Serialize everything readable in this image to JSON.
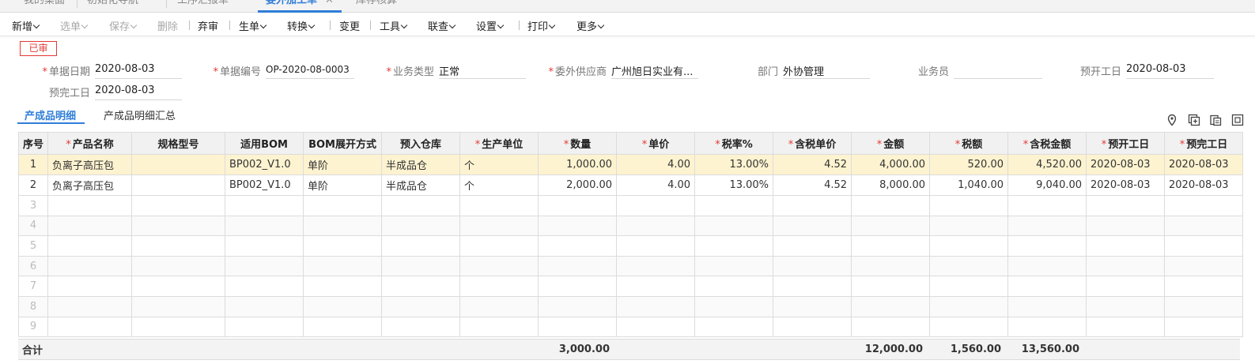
{
  "tabs": [
    {
      "label": "我的桌面"
    },
    {
      "label": "初始化导航"
    },
    {
      "label": "工序汇报单"
    },
    {
      "label": "委外加工单",
      "active": true
    },
    {
      "label": "库存核算"
    }
  ],
  "tab_close": "✕",
  "toolbar": {
    "items": [
      "新增",
      "选单",
      "保存",
      "删除",
      "弃审",
      "生单",
      "转换",
      "变更",
      "工具",
      "联查",
      "设置",
      "打印",
      "更多"
    ]
  },
  "status_badge": "已审",
  "form": {
    "doc_date": {
      "label": "单据日期",
      "value": "2020-08-03"
    },
    "doc_no": {
      "label": "单据编号",
      "value": "OP-2020-08-0003"
    },
    "biz_type": {
      "label": "业务类型",
      "value": "正常"
    },
    "supplier": {
      "label": "委外供应商",
      "value": "广州旭日实业有..."
    },
    "dept": {
      "label": "部门",
      "value": "外协管理"
    },
    "clerk": {
      "label": "业务员",
      "value": ""
    },
    "plan_start": {
      "label": "预开工日",
      "value": "2020-08-03"
    },
    "plan_finish": {
      "label": "预完工日",
      "value": "2020-08-03"
    }
  },
  "subtabs": [
    "产成品明细",
    "产成品明细汇总"
  ],
  "icons": [
    "location-pin-icon",
    "add-row-icon",
    "copy-icon",
    "expand-icon"
  ],
  "grid": {
    "columns": [
      "序号",
      "产品名称",
      "规格型号",
      "适用BOM",
      "BOM展开方式",
      "预入仓库",
      "生产单位",
      "数量",
      "单价",
      "税率%",
      "含税单价",
      "金额",
      "税额",
      "含税金额",
      "预开工日",
      "预完工日"
    ],
    "required": [
      false,
      true,
      false,
      false,
      false,
      false,
      true,
      true,
      true,
      true,
      true,
      true,
      true,
      true,
      true,
      true
    ],
    "rows": [
      [
        "1",
        "负离子高压包",
        "",
        "BP002_V1.0",
        "单阶",
        "半成品仓",
        "个",
        "1,000.00",
        "4.00",
        "13.00%",
        "4.52",
        "4,000.00",
        "520.00",
        "4,520.00",
        "2020-08-03",
        "2020-08-03"
      ],
      [
        "2",
        "负离子高压包",
        "",
        "BP002_V1.0",
        "单阶",
        "半成品仓",
        "个",
        "2,000.00",
        "4.00",
        "13.00%",
        "4.52",
        "8,000.00",
        "1,040.00",
        "9,040.00",
        "2020-08-03",
        "2020-08-03"
      ]
    ],
    "empty_rows": [
      "3",
      "4",
      "5",
      "6",
      "7",
      "8",
      "9"
    ]
  },
  "totals": {
    "label": "合计",
    "quantity": "3,000.00",
    "amount": "12,000.00",
    "tax": "1,560.00",
    "amount_with_tax": "13,560.00"
  },
  "colors": {
    "accent": "#2f7ed8",
    "required": "#e53935",
    "selected_row": "#fdf3d0"
  }
}
